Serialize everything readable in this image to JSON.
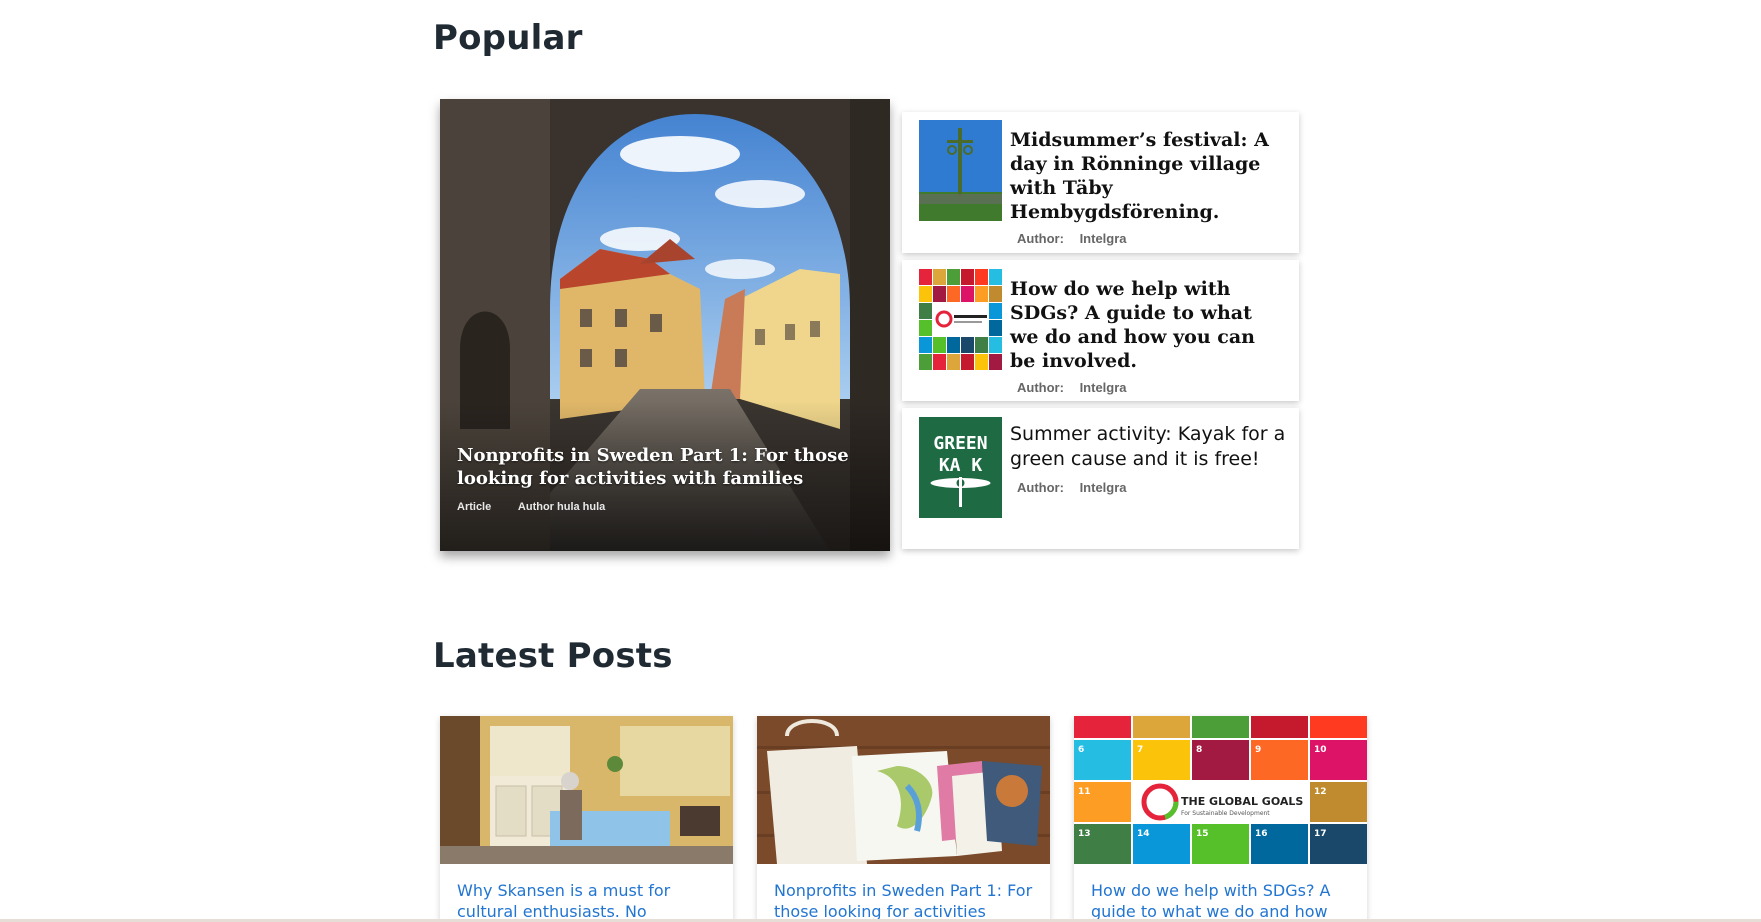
{
  "popular": {
    "title": "Popular",
    "featured": {
      "title": "Nonprofits in Sweden Part 1: For those looking for activities with families",
      "type": "Article",
      "author": "Author hula hula"
    },
    "items": [
      {
        "title": "Midsummer’s festival: A day in Rönninge village with Täby Hembygdsförening.",
        "author_label": "Author:",
        "author": "Intelgra"
      },
      {
        "title": "How do we help with SDGs? A guide to what we do and how you can be involved.",
        "author_label": "Author:",
        "author": "Intelgra"
      },
      {
        "title": "Summer activity: Kayak for a green cause and it is free!",
        "author_label": "Author:",
        "author": "Intelgra",
        "thumb_text": "GREEN KAYAK"
      }
    ]
  },
  "latest": {
    "title": "Latest Posts",
    "posts": [
      {
        "title": "Why Skansen is a must for cultural enthusiasts. No"
      },
      {
        "title": "Nonprofits in Sweden Part 1: For those looking for activities"
      },
      {
        "title": "How do we help with SDGs? A guide to what we do and how"
      }
    ],
    "sdg_banner": {
      "title": "THE GLOBAL GOALS",
      "subtitle": "For Sustainable Development",
      "tiles": [
        "6",
        "7",
        "8",
        "9",
        "10",
        "11",
        "12",
        "13",
        "14",
        "15",
        "16",
        "17"
      ]
    }
  },
  "colors": {
    "link": "#2275d1",
    "heading": "#1f2a33",
    "kayak_green": "#1e6b43"
  }
}
